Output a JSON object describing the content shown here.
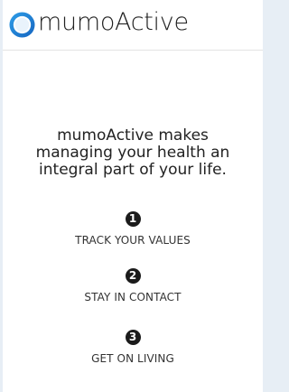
{
  "header": {
    "brand": "mumoActive",
    "logo_icon": "mumoactive-logo-icon",
    "brand_color": "#1e88e5"
  },
  "tagline": {
    "line1": "mumoActive makes",
    "line2": "managing your health an",
    "line3": "integral part of your life."
  },
  "steps": [
    {
      "number": "1",
      "label": "TRACK YOUR VALUES"
    },
    {
      "number": "2",
      "label": "STAY IN CONTACT"
    },
    {
      "number": "3",
      "label": "GET ON LIVING"
    }
  ]
}
